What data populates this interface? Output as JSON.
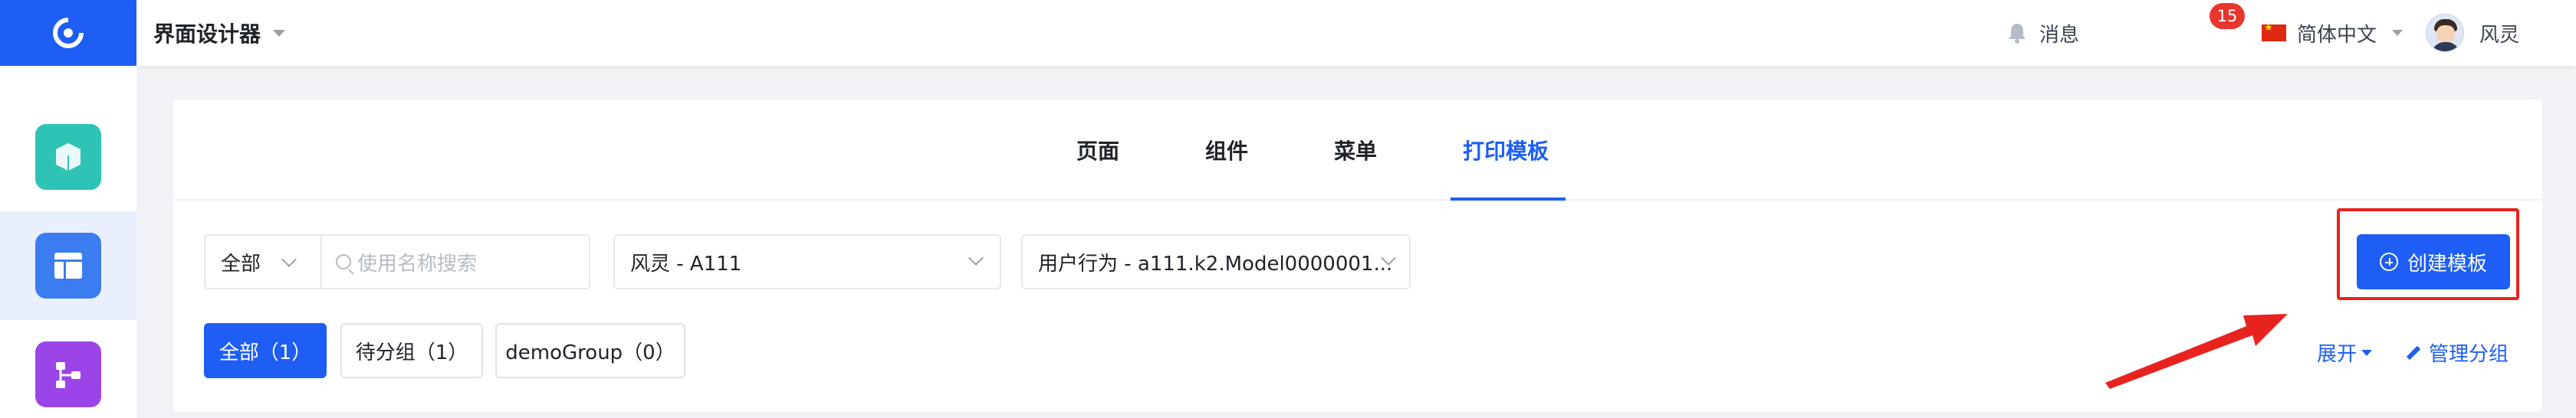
{
  "header": {
    "app_title": "界面设计器",
    "messages_label": "消息",
    "messages_count": "15",
    "language_label": "简体中文",
    "user_name": "风灵"
  },
  "sidebar": {
    "items": [
      {
        "icon": "cube-icon",
        "color": "#2fc3b5"
      },
      {
        "icon": "layout-icon",
        "color": "#3b7cf0"
      },
      {
        "icon": "flow-icon",
        "color": "#9b45e8"
      }
    ]
  },
  "tabs": [
    {
      "label": "页面",
      "active": false
    },
    {
      "label": "组件",
      "active": false
    },
    {
      "label": "菜单",
      "active": false
    },
    {
      "label": "打印模板",
      "active": true
    }
  ],
  "filters": {
    "scope_value": "全部",
    "search_placeholder": "使用名称搜索",
    "app_value": "风灵 - A111",
    "model_value": "用户行为 - a111.k2.Model0000001..."
  },
  "actions": {
    "create_label": "创建模板",
    "expand_label": "展开",
    "manage_label": "管理分组"
  },
  "groups": [
    {
      "label": "全部（1）",
      "active": true
    },
    {
      "label": "待分组（1）",
      "active": false
    },
    {
      "label": "demoGroup（0）",
      "active": false
    }
  ],
  "colors": {
    "primary": "#1e5ef5",
    "highlight": "#e8231f"
  }
}
